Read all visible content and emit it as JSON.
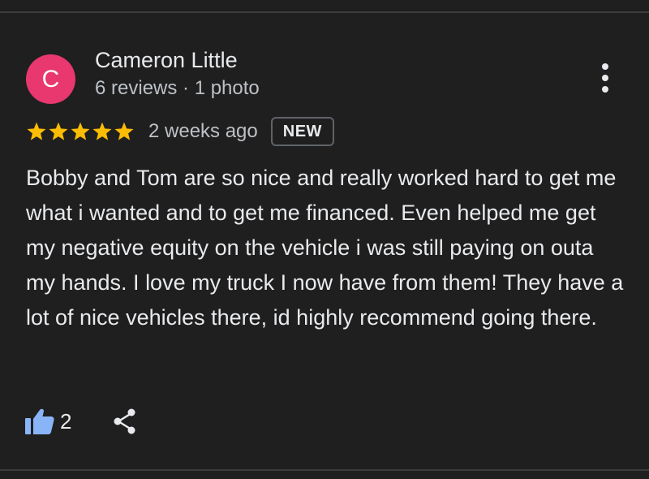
{
  "review": {
    "author": {
      "initial": "C",
      "name": "Cameron Little",
      "meta": "6 reviews · 1 photo",
      "avatar_color": "#e8386f"
    },
    "rating": 5,
    "star_color": "#fbbc04",
    "time_ago": "2 weeks ago",
    "badge": "NEW",
    "text": "Bobby and Tom are so nice and really worked hard to get me what i wanted and to get me financed. Even helped me get my negative equity on the vehicle i was still paying on outa my hands. I love my truck I now have from them! They have a lot of nice vehicles there, id highly recommend going there.",
    "likes": "2",
    "like_icon_color": "#8ab4f8"
  },
  "icons": {
    "more": "more-vert-icon",
    "like": "thumbs-up-icon",
    "share": "share-icon",
    "star": "star-icon"
  }
}
